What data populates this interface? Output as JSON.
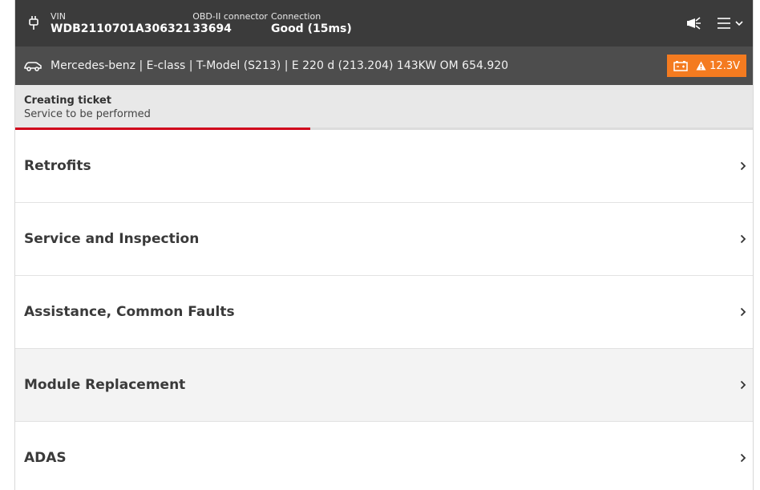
{
  "header": {
    "vin_label": "VIN",
    "vin_value": "WDB2110701A306321",
    "obd_label": "OBD-II connector",
    "obd_value": "33694",
    "conn_label": "Connection",
    "conn_value": "Good (15ms)",
    "icons": [
      "plug-icon",
      "megaphone-icon",
      "menu-icon",
      "chevron-down-icon"
    ]
  },
  "vehicle": {
    "description": "Mercedes-benz | E-class | T-Model (S213) | E 220 d (213.204) 143KW OM 654.920",
    "battery_voltage": "12.3V",
    "badge_color": "#f47b20"
  },
  "ticket": {
    "title": "Creating ticket",
    "subtitle": "Service to be performed",
    "progress": 0.4,
    "progress_color": "#d0021b"
  },
  "menu": {
    "items": [
      {
        "label": "Retrofits"
      },
      {
        "label": "Service and Inspection"
      },
      {
        "label": "Assistance, Common Faults"
      },
      {
        "label": "Module Replacement"
      },
      {
        "label": "ADAS"
      }
    ]
  }
}
